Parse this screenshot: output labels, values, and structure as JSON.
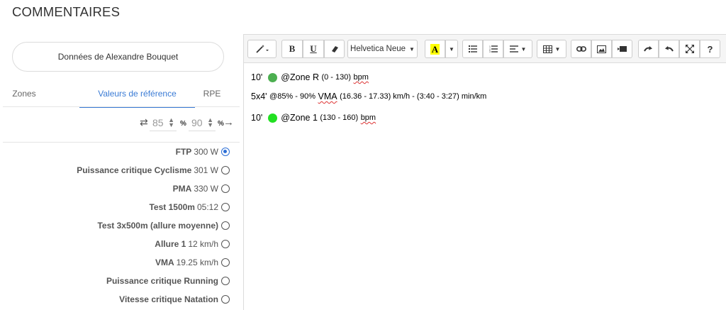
{
  "page_title": "COMMENTAIRES",
  "athlete_button": "Données de Alexandre Bouquet",
  "tabs": [
    {
      "label": "Zones"
    },
    {
      "label": "Valeurs de référence"
    },
    {
      "label": "RPE"
    }
  ],
  "range": {
    "min": "85",
    "max": "90",
    "unit": "%",
    "swap_icon": "⇄",
    "apply_icon": "→"
  },
  "references": [
    {
      "name": "FTP",
      "value": "300 W",
      "selected": true
    },
    {
      "name": "Puissance critique Cyclisme",
      "value": "301 W",
      "selected": false
    },
    {
      "name": "PMA",
      "value": "330 W",
      "selected": false
    },
    {
      "name": "Test 1500m",
      "value": "05:12",
      "selected": false
    },
    {
      "name": "Test 3x500m (allure moyenne)",
      "value": "",
      "selected": false
    },
    {
      "name": "Allure 1",
      "value": "12 km/h",
      "selected": false
    },
    {
      "name": "VMA",
      "value": "19.25 km/h",
      "selected": false
    },
    {
      "name": "Puissance critique Running",
      "value": "",
      "selected": false
    },
    {
      "name": "Vitesse critique Natation",
      "value": "",
      "selected": false
    }
  ],
  "toolbar": {
    "magic": "magic-wand-icon",
    "bold": "B",
    "underline": "U",
    "eraser": "eraser-icon",
    "font_name": "Helvetica Neue",
    "color_letter": "A",
    "highlight_color": "#ffff00",
    "icons": [
      "unordered-list-icon",
      "ordered-list-icon",
      "align-icon",
      "table-icon",
      "link-icon",
      "image-icon",
      "video-icon",
      "redo-icon",
      "undo-icon",
      "fullscreen-icon",
      "help-icon"
    ],
    "help": "?"
  },
  "content": {
    "line1": {
      "duration": "10'",
      "zone": "@Zone R",
      "range": "(0 - 130)",
      "unit": "bpm",
      "dot_color": "#4caf50"
    },
    "line2": {
      "reps": "5x4'",
      "pct": "@85% - 90%",
      "ref": "VMA",
      "speed": "(16.36 - 17.33) km/h - (3:40 - 3:27) min/km"
    },
    "line3": {
      "duration": "10'",
      "zone": "@Zone 1",
      "range": "(130 - 160)",
      "unit": "bpm",
      "dot_color": "#22e022"
    }
  }
}
